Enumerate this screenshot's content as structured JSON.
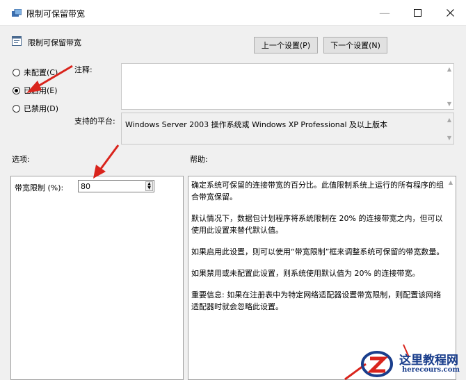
{
  "window": {
    "title": "限制可保留带宽",
    "controls": [
      "minimize-icon",
      "maximize-icon",
      "close-icon"
    ]
  },
  "header": {
    "policy_name": "限制可保留带宽",
    "prev_button": "上一个设置(P)",
    "next_button": "下一个设置(N)"
  },
  "state": {
    "options": [
      {
        "label": "未配置(C)",
        "selected": false
      },
      {
        "label": "已启用(E)",
        "selected": true
      },
      {
        "label": "已禁用(D)",
        "selected": false
      }
    ]
  },
  "comment": {
    "label": "注释:",
    "value": ""
  },
  "platform": {
    "label": "支持的平台:",
    "value": "Windows Server 2003 操作系统或 Windows XP Professional 及以上版本"
  },
  "options_section": {
    "label": "选项:",
    "bandwidth_label": "带宽限制 (%):",
    "bandwidth_value": "80"
  },
  "help_section": {
    "label": "帮助:",
    "paragraphs": [
      "确定系统可保留的连接带宽的百分比。此值限制系统上运行的所有程序的组合带宽保留。",
      "默认情况下，数据包计划程序将系统限制在 20% 的连接带宽之内，但可以使用此设置来替代默认值。",
      "如果启用此设置，则可以使用“带宽限制”框来调整系统可保留的带宽数量。",
      "如果禁用或未配置此设置，则系统使用默认值为 20% 的连接带宽。",
      "重要信息: 如果在注册表中为特定网络适配器设置带宽限制，则配置该网络适配器时就会忽略此设置。"
    ]
  },
  "watermark": {
    "cn": "这里教程网",
    "en": "herecours.com"
  },
  "colors": {
    "accent_arrow": "#d9241c",
    "watermark": "#1a3e8c"
  }
}
